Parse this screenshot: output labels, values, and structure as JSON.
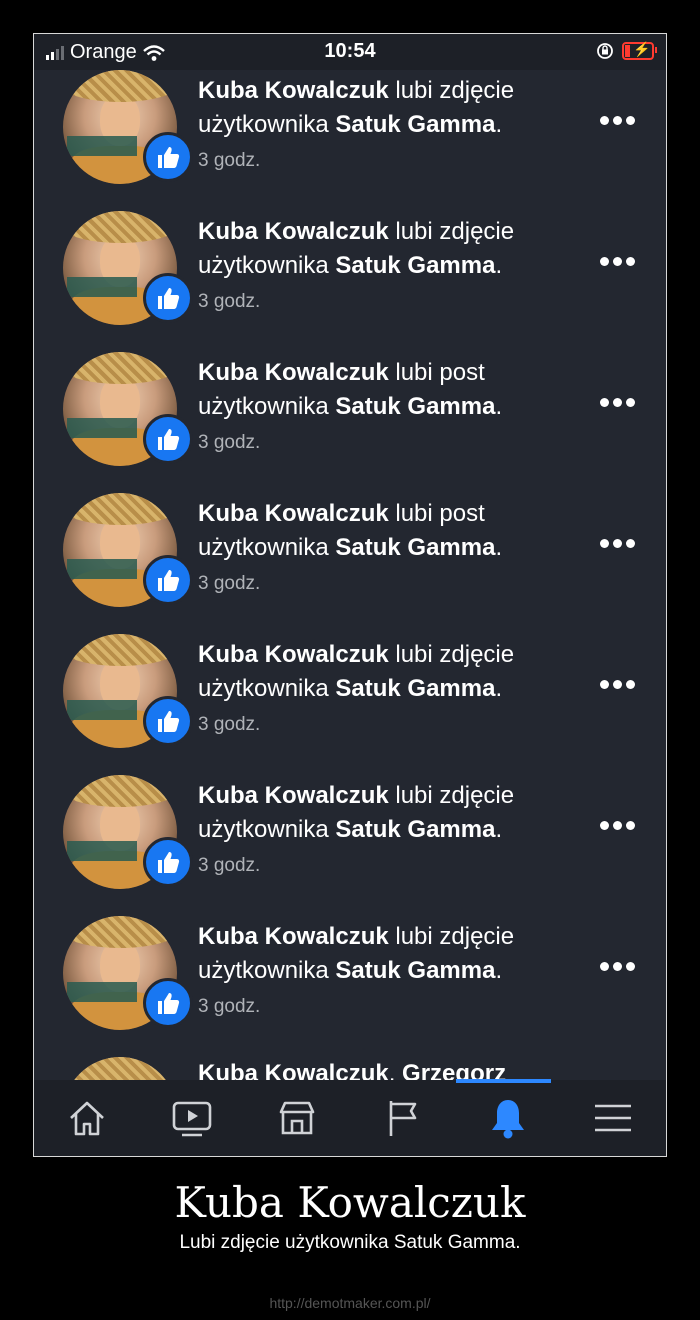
{
  "status_bar": {
    "carrier": "Orange",
    "time": "10:54",
    "signal_icon": "signal-bars-icon",
    "wifi_icon": "wifi-icon",
    "rotation_lock_icon": "rotation-lock-icon",
    "battery_icon": "battery-charging-icon"
  },
  "notifications": [
    {
      "actor": "Kuba Kowalczuk",
      "verb": " lubi zdjęcie",
      "target_prefix": "użytkownika ",
      "target": "Satuk Gamma",
      "suffix": ".",
      "time": "3 godz."
    },
    {
      "actor": "Kuba Kowalczuk",
      "verb": " lubi zdjęcie",
      "target_prefix": "użytkownika ",
      "target": "Satuk Gamma",
      "suffix": ".",
      "time": "3 godz."
    },
    {
      "actor": "Kuba Kowalczuk",
      "verb": " lubi post",
      "target_prefix": "użytkownika ",
      "target": "Satuk Gamma",
      "suffix": ".",
      "time": "3 godz."
    },
    {
      "actor": "Kuba Kowalczuk",
      "verb": " lubi post",
      "target_prefix": "użytkownika ",
      "target": "Satuk Gamma",
      "suffix": ".",
      "time": "3 godz."
    },
    {
      "actor": "Kuba Kowalczuk",
      "verb": " lubi zdjęcie",
      "target_prefix": "użytkownika ",
      "target": "Satuk Gamma",
      "suffix": ".",
      "time": "3 godz."
    },
    {
      "actor": "Kuba Kowalczuk",
      "verb": " lubi zdjęcie",
      "target_prefix": "użytkownika ",
      "target": "Satuk Gamma",
      "suffix": ".",
      "time": "3 godz."
    },
    {
      "actor": "Kuba Kowalczuk",
      "verb": " lubi zdjęcie",
      "target_prefix": "użytkownika ",
      "target": "Satuk Gamma",
      "suffix": ".",
      "time": "3 godz."
    }
  ],
  "partial_notification": {
    "actor": "Kuba Kowalczuk",
    "sep": ", ",
    "second_actor": "Grzegorz"
  },
  "bottom_nav": {
    "items": [
      "home-icon",
      "watch-video-icon",
      "marketplace-icon",
      "pages-flag-icon",
      "notifications-bell-icon",
      "menu-icon"
    ],
    "active": "notifications-bell-icon",
    "accent_color": "#2d88ff"
  },
  "caption": {
    "title": "Kuba Kowalczuk",
    "subtitle": "Lubi zdjęcie użytkownika Satuk Gamma.",
    "watermark": "http://demotmaker.com.pl/"
  },
  "colors": {
    "like_badge": "#1877f2",
    "background": "#232730"
  }
}
